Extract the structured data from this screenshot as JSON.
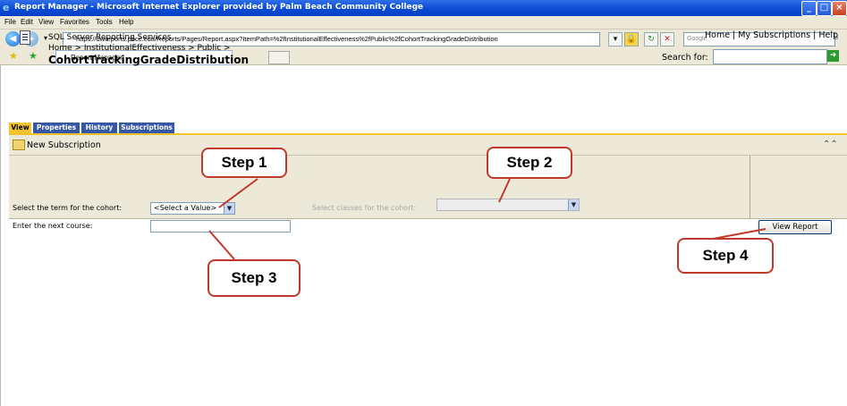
{
  "window": {
    "title": "Report Manager - Microsoft Internet Explorer provided by Palm Beach Community College"
  },
  "menu": [
    "File",
    "Edit",
    "View",
    "Favorites",
    "Tools",
    "Help"
  ],
  "address": {
    "url": "https://dwreports.pbcc.edu/Reports/Pages/Report.aspx?ItemPath=%2fInstitutionalEffectiveness%2fPublic%2fCohortTrackingGradeDistribution",
    "search_placeholder": "Google"
  },
  "browser_tab": {
    "label": "Report Manager"
  },
  "header": {
    "product": "SQL Server Reporting Services",
    "breadcrumb": "Home > InstitutionalEffectiveness > Public >",
    "title": "CohortTrackingGradeDistribution",
    "top_links": "Home | My Subscriptions | Help",
    "search_label": "Search for:"
  },
  "report_tabs": [
    "View",
    "Properties",
    "History",
    "Subscriptions"
  ],
  "toolbar": {
    "new_subscription": "New Subscription"
  },
  "params": {
    "term_label": "Select the term for the cohort:",
    "term_value": "<Select a Value>",
    "classes_label": "Select classes for the cohort:",
    "course_label": "Enter the next course:",
    "view_report": "View Report"
  },
  "callouts": [
    "Step 1",
    "Step 2",
    "Step 3",
    "Step 4"
  ],
  "colors": {
    "callout_border": "#c0392b",
    "tab_active": "#f4c430",
    "tab_inactive": "#3656a8"
  }
}
